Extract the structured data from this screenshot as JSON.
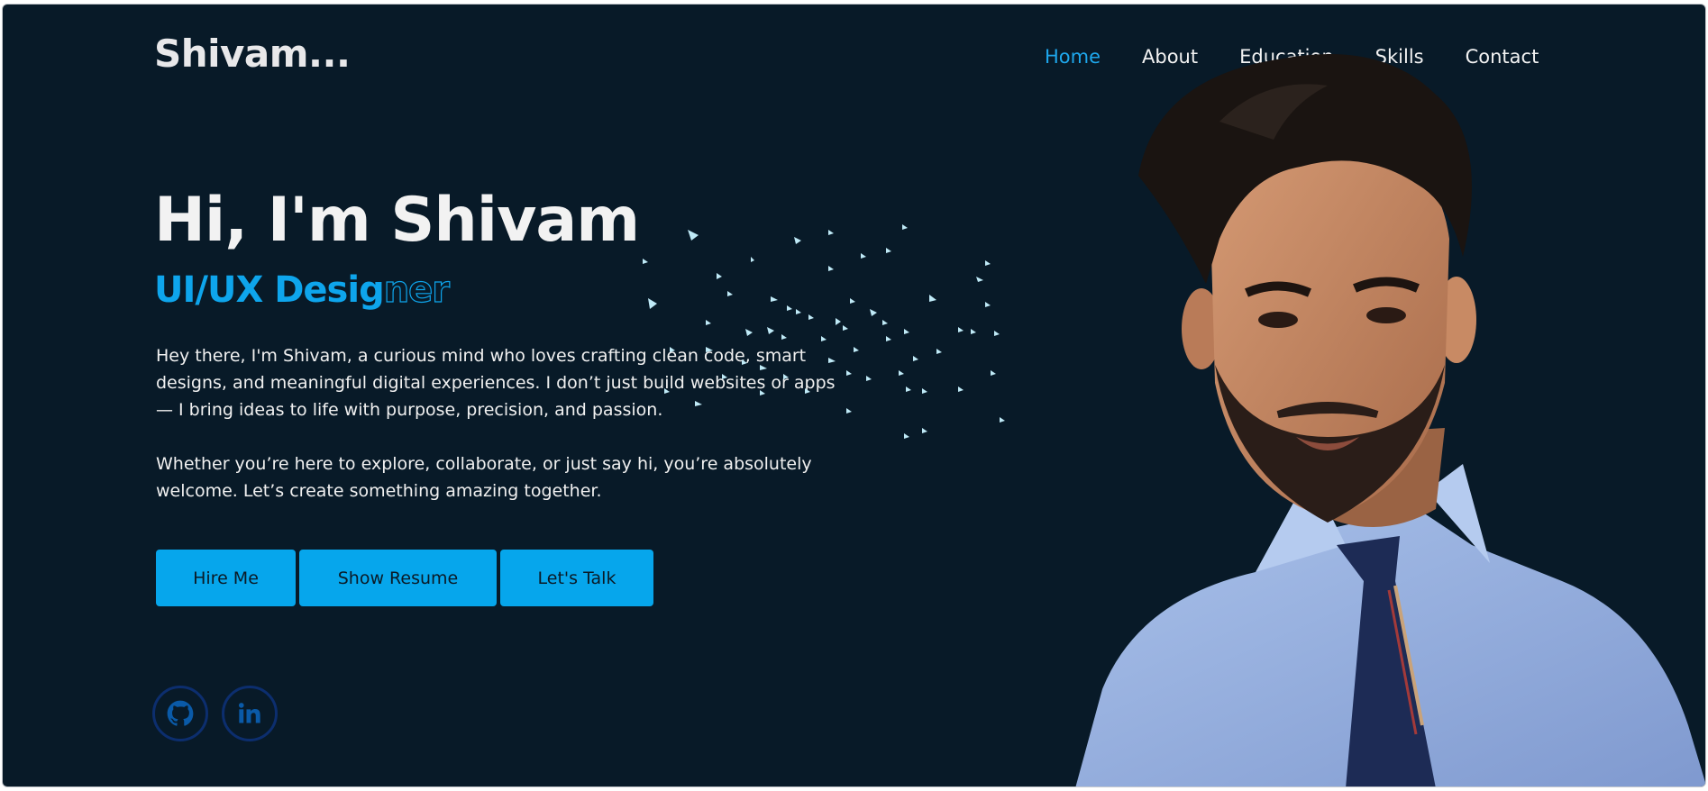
{
  "header": {
    "logo": "Shivam...",
    "nav": [
      {
        "label": "Home",
        "active": true
      },
      {
        "label": "About",
        "active": false
      },
      {
        "label": "Education",
        "active": false
      },
      {
        "label": "Skills",
        "active": false
      },
      {
        "label": "Contact",
        "active": false
      }
    ]
  },
  "hero": {
    "title": "Hi, I'm Shivam",
    "role_solid": "UI/UX Desig",
    "role_outline": "ner",
    "paragraph1": "Hey there, I'm Shivam, a curious mind who loves crafting clean code, smart designs, and meaningful digital experiences. I don’t just build websites or apps — I bring ideas to life with purpose, precision, and passion.",
    "paragraph2": "Whether you’re here to explore, collaborate, or just say hi, you’re absolutely welcome. Let’s create something amazing together."
  },
  "buttons": {
    "hire": "Hire Me",
    "resume": "Show Resume",
    "talk": "Let's Talk"
  },
  "social": {
    "github_icon": "github-icon",
    "linkedin_icon": "linkedin-icon"
  },
  "colors": {
    "background": "#081a28",
    "accent": "#0ea5ec",
    "text": "#f2f2f2",
    "social_ring": "#0c2e6e"
  }
}
